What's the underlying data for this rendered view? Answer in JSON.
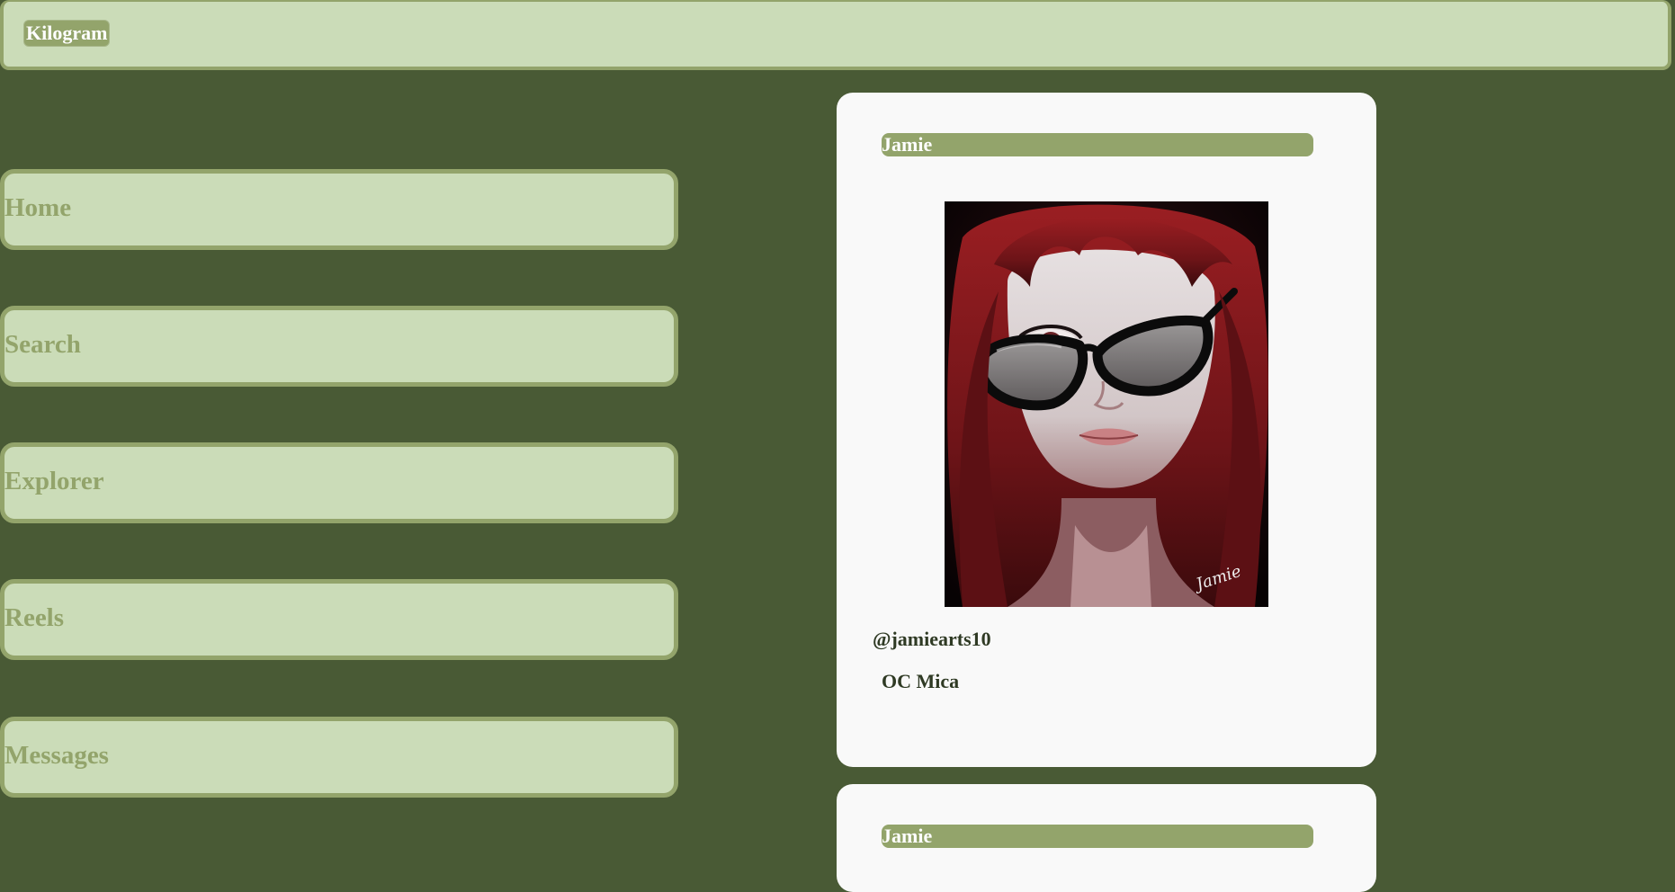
{
  "app": {
    "title": "Kilogram"
  },
  "nav": {
    "items": [
      {
        "label": "Home"
      },
      {
        "label": "Search"
      },
      {
        "label": "Explorer"
      },
      {
        "label": "Reels"
      },
      {
        "label": "Messages"
      }
    ]
  },
  "feed": {
    "posts": [
      {
        "author": "Jamie",
        "handle": "@jamiearts10",
        "caption": "OC Mica",
        "image_signature": "Jamie"
      },
      {
        "author": "Jamie"
      }
    ]
  },
  "colors": {
    "background": "#495a35",
    "panel": "#cbdcb8",
    "accent": "#93a46b",
    "card": "#f9f9f9",
    "text_dark": "#2f3a24"
  }
}
